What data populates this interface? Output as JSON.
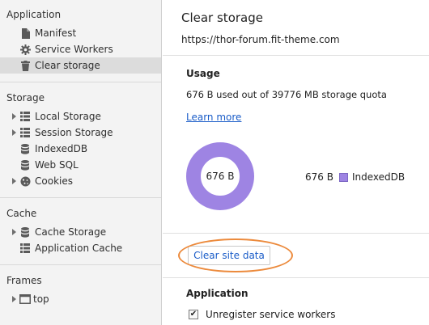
{
  "sidebar": {
    "sections": {
      "application": {
        "title": "Application",
        "items": [
          {
            "label": "Manifest",
            "icon": "document-icon"
          },
          {
            "label": "Service Workers",
            "icon": "gear-icon"
          },
          {
            "label": "Clear storage",
            "icon": "trash-icon",
            "selected": true
          }
        ]
      },
      "storage": {
        "title": "Storage",
        "items": [
          {
            "label": "Local Storage",
            "icon": "grid-icon",
            "expandable": true
          },
          {
            "label": "Session Storage",
            "icon": "grid-icon",
            "expandable": true
          },
          {
            "label": "IndexedDB",
            "icon": "database-icon"
          },
          {
            "label": "Web SQL",
            "icon": "database-icon"
          },
          {
            "label": "Cookies",
            "icon": "cookie-icon",
            "expandable": true
          }
        ]
      },
      "cache": {
        "title": "Cache",
        "items": [
          {
            "label": "Cache Storage",
            "icon": "database-icon",
            "expandable": true
          },
          {
            "label": "Application Cache",
            "icon": "grid-icon"
          }
        ]
      },
      "frames": {
        "title": "Frames",
        "items": [
          {
            "label": "top",
            "icon": "frame-icon",
            "expandable": true
          }
        ]
      }
    }
  },
  "main": {
    "title": "Clear storage",
    "url": "https://thor-forum.fit-theme.com",
    "usage": {
      "heading": "Usage",
      "summary": "676 B used out of 39776 MB storage quota",
      "learn_more": "Learn more",
      "chart_center": "676 B",
      "legend_value": "676 B",
      "legend_label": "IndexedDB",
      "legend_color": "#9e84e3"
    },
    "clear_button": "Clear site data",
    "application": {
      "heading": "Application",
      "checkbox_label": "Unregister service workers",
      "checked": true
    }
  },
  "colors": {
    "accent": "#1a5cc8",
    "donut": "#9e84e3",
    "highlight_ellipse": "#ec8a3c",
    "selected_bg": "#dcdcdc"
  }
}
